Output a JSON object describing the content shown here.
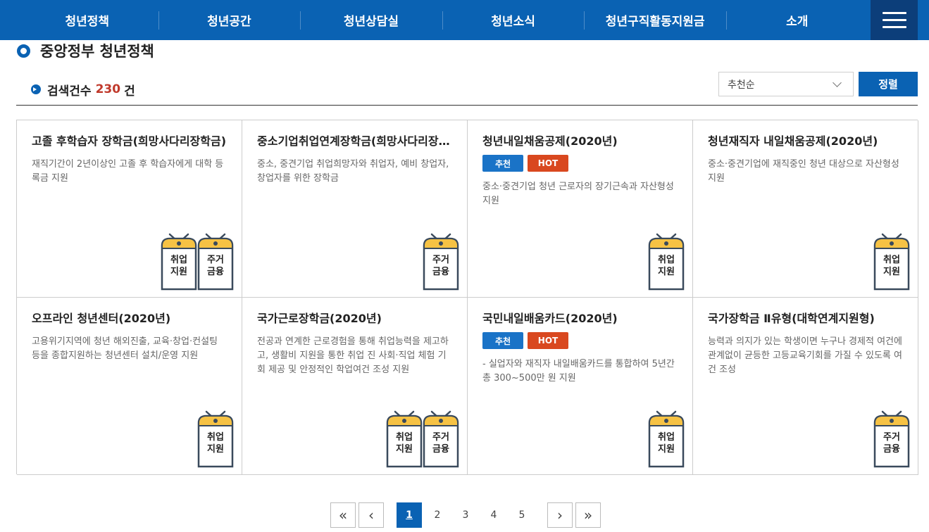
{
  "nav": {
    "items": [
      "청년정책",
      "청년공간",
      "청년상담실",
      "청년소식",
      "청년구직활동지원금",
      "소개"
    ],
    "menu_icon": "hamburger-menu-icon"
  },
  "page": {
    "title": "중앙정부 청년정책",
    "count_label": "검색건수",
    "count_value": "230",
    "count_unit": "건"
  },
  "sort": {
    "selected": "추천순",
    "button": "정렬"
  },
  "cards": [
    {
      "title": "고졸 후학습자 장학금(희망사다리장학금)",
      "badges": [],
      "desc": "재직기간이 2년이상인 고졸 후 학습자에게 대학 등록금 지원",
      "tags": [
        [
          "취업",
          "지원"
        ],
        [
          "주거",
          "금융"
        ]
      ]
    },
    {
      "title": "중소기업취업연계장학금(희망사다리장학금)",
      "badges": [],
      "desc": "중소, 중견기업 취업희망자와 취업자, 예비 창업자, 창업자를 위한 장학금",
      "tags": [
        [
          "주거",
          "금융"
        ]
      ]
    },
    {
      "title": "청년내일채움공제(2020년)",
      "badges": [
        "추천",
        "HOT"
      ],
      "desc": "중소·중견기업 청년 근로자의 장기근속과 자산형성 지원",
      "tags": [
        [
          "취업",
          "지원"
        ]
      ]
    },
    {
      "title": "청년재직자 내일채움공제(2020년)",
      "badges": [],
      "desc": "중소·중견기업에 재직중인 청년 대상으로 자산형성 지원",
      "tags": [
        [
          "취업",
          "지원"
        ]
      ]
    },
    {
      "title": "오프라인 청년센터(2020년)",
      "badges": [],
      "desc": "고용위기지역에 청년 해외진출, 교육·창업·컨설팅 등을 종합지원하는 청년센터 설치/운영 지원",
      "tags": [
        [
          "취업",
          "지원"
        ]
      ]
    },
    {
      "title": "국가근로장학금(2020년)",
      "badges": [],
      "desc": "전공과 연계한 근로경험을 통해 취업능력을 제고하고, 생활비 지원을 통한 취업 진 사회·직업 체험 기회 제공 및 안정적인 학업여건 조성 지원",
      "tags": [
        [
          "취업",
          "지원"
        ],
        [
          "주거",
          "금융"
        ]
      ]
    },
    {
      "title": "국민내일배움카드(2020년)",
      "badges": [
        "추천",
        "HOT"
      ],
      "desc": "- 실업자와 재직자 내일배움카드를 통합하여 5년간 총 300~500만 원 지원",
      "tags": [
        [
          "취업",
          "지원"
        ]
      ]
    },
    {
      "title": "국가장학금 Ⅱ유형(대학연계지원형)",
      "badges": [],
      "desc": "능력과 의지가 있는 학생이면 누구나 경제적 여건에 관계없이 균등한 고등교육기회를 가질 수 있도록 여건 조성",
      "tags": [
        [
          "주거",
          "금융"
        ]
      ]
    }
  ],
  "pagination": {
    "first": "«",
    "prev": "‹",
    "pages": [
      "1",
      "2",
      "3",
      "4",
      "5"
    ],
    "current": "1",
    "next": "›",
    "last": "»"
  },
  "colors": {
    "brand": "#0a62b3",
    "nav_dark": "#0c3e7a",
    "hot": "#d9481f",
    "count": "#c0392b",
    "tag_fill": "#f6c244",
    "tag_stroke": "#3a4a5c"
  }
}
